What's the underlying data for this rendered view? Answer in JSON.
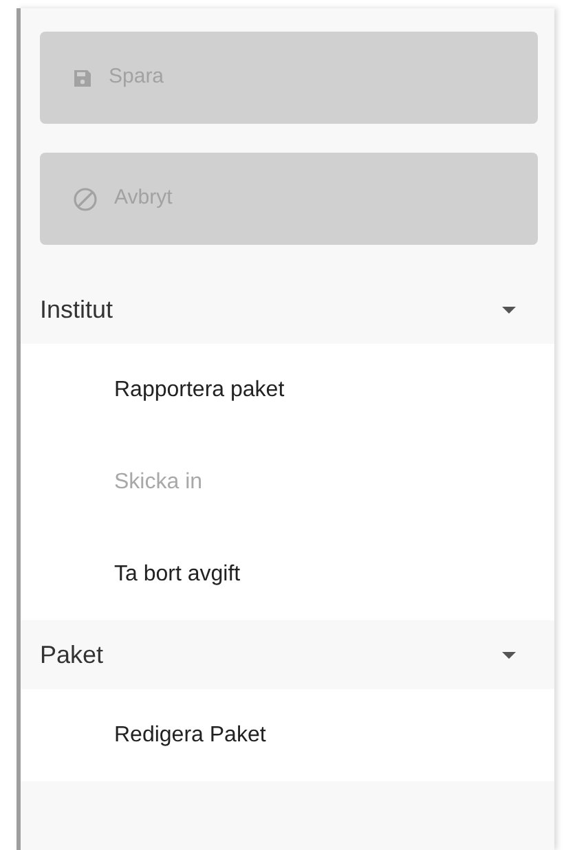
{
  "buttons": [
    {
      "kind": "save",
      "label": "Spara",
      "disabled": true
    },
    {
      "kind": "cancel",
      "label": "Avbryt",
      "disabled": true
    }
  ],
  "sections": [
    {
      "title": "Institut",
      "expanded": true,
      "items": [
        {
          "label": "Rapportera paket",
          "disabled": false
        },
        {
          "label": "Skicka in",
          "disabled": true
        },
        {
          "label": "Ta bort avgift",
          "disabled": false
        }
      ]
    },
    {
      "title": "Paket",
      "expanded": true,
      "items": [
        {
          "label": "Redigera Paket",
          "disabled": false
        }
      ]
    }
  ]
}
